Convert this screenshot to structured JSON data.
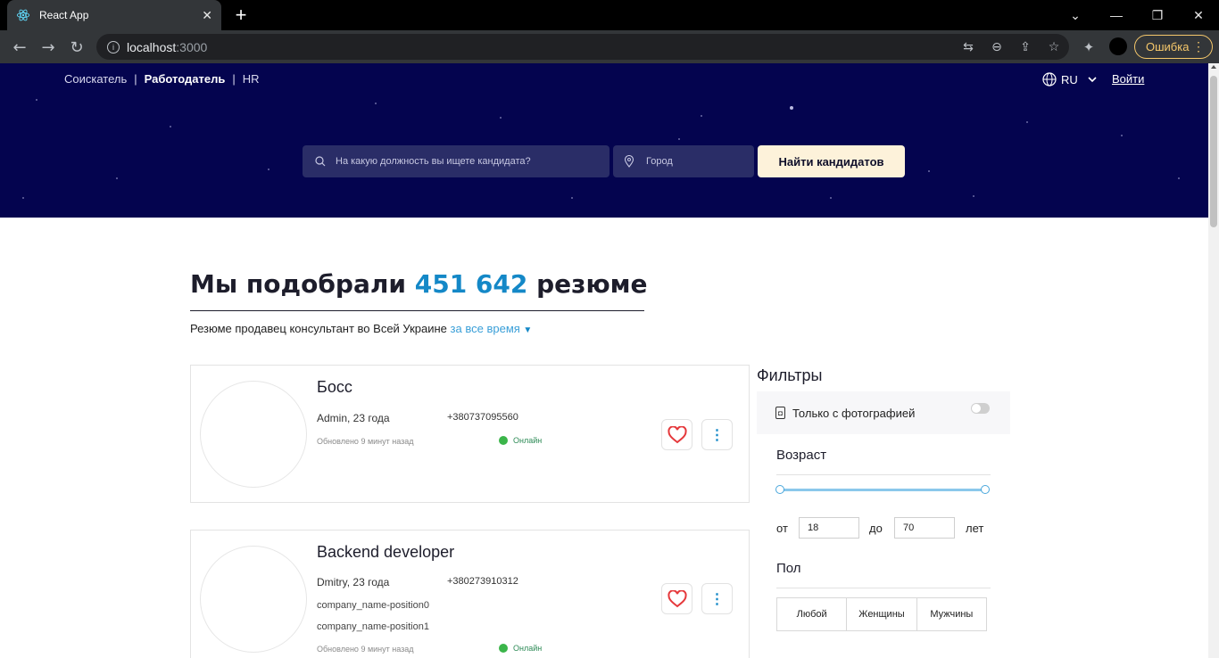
{
  "browser": {
    "tab_title": "React App",
    "url_host": "localhost",
    "url_port": ":3000",
    "error_label": "Ошибка"
  },
  "header": {
    "nav": [
      "Соискатель",
      "Работодатель",
      "HR"
    ],
    "nav_separator": "|",
    "lang": "RU",
    "login": "Войти",
    "search_placeholder": "На какую должность вы ищете кандидата?",
    "city_placeholder": "Город",
    "find_button": "Найти кандидатов"
  },
  "results": {
    "heading_prefix": "Мы подобрали",
    "count": "451 642",
    "heading_suffix": "резюме",
    "subheading": "Резюме продавец консультант во Всей Украине",
    "period": "за все время"
  },
  "cards": [
    {
      "title": "Босс",
      "person": "Admin, 23 года",
      "phone": "+380737095560",
      "positions": [],
      "updated": "Обновлено 9 минут назад",
      "status": "Онлайн"
    },
    {
      "title": "Backend developer",
      "person": "Dmitry, 23 года",
      "phone": "+380273910312",
      "positions": [
        "company_name-position0",
        "company_name-position1"
      ],
      "updated": "Обновлено 9 минут назад",
      "status": "Онлайн"
    }
  ],
  "filters": {
    "title": "Фильтры",
    "photo_only": "Только с фотографией",
    "age_title": "Возраст",
    "age_from_label": "от",
    "age_from": "18",
    "age_to_label": "до",
    "age_to": "70",
    "age_unit": "лет",
    "gender_title": "Пол",
    "gender_options": [
      "Любой",
      "Женщины",
      "Мужчины"
    ]
  }
}
